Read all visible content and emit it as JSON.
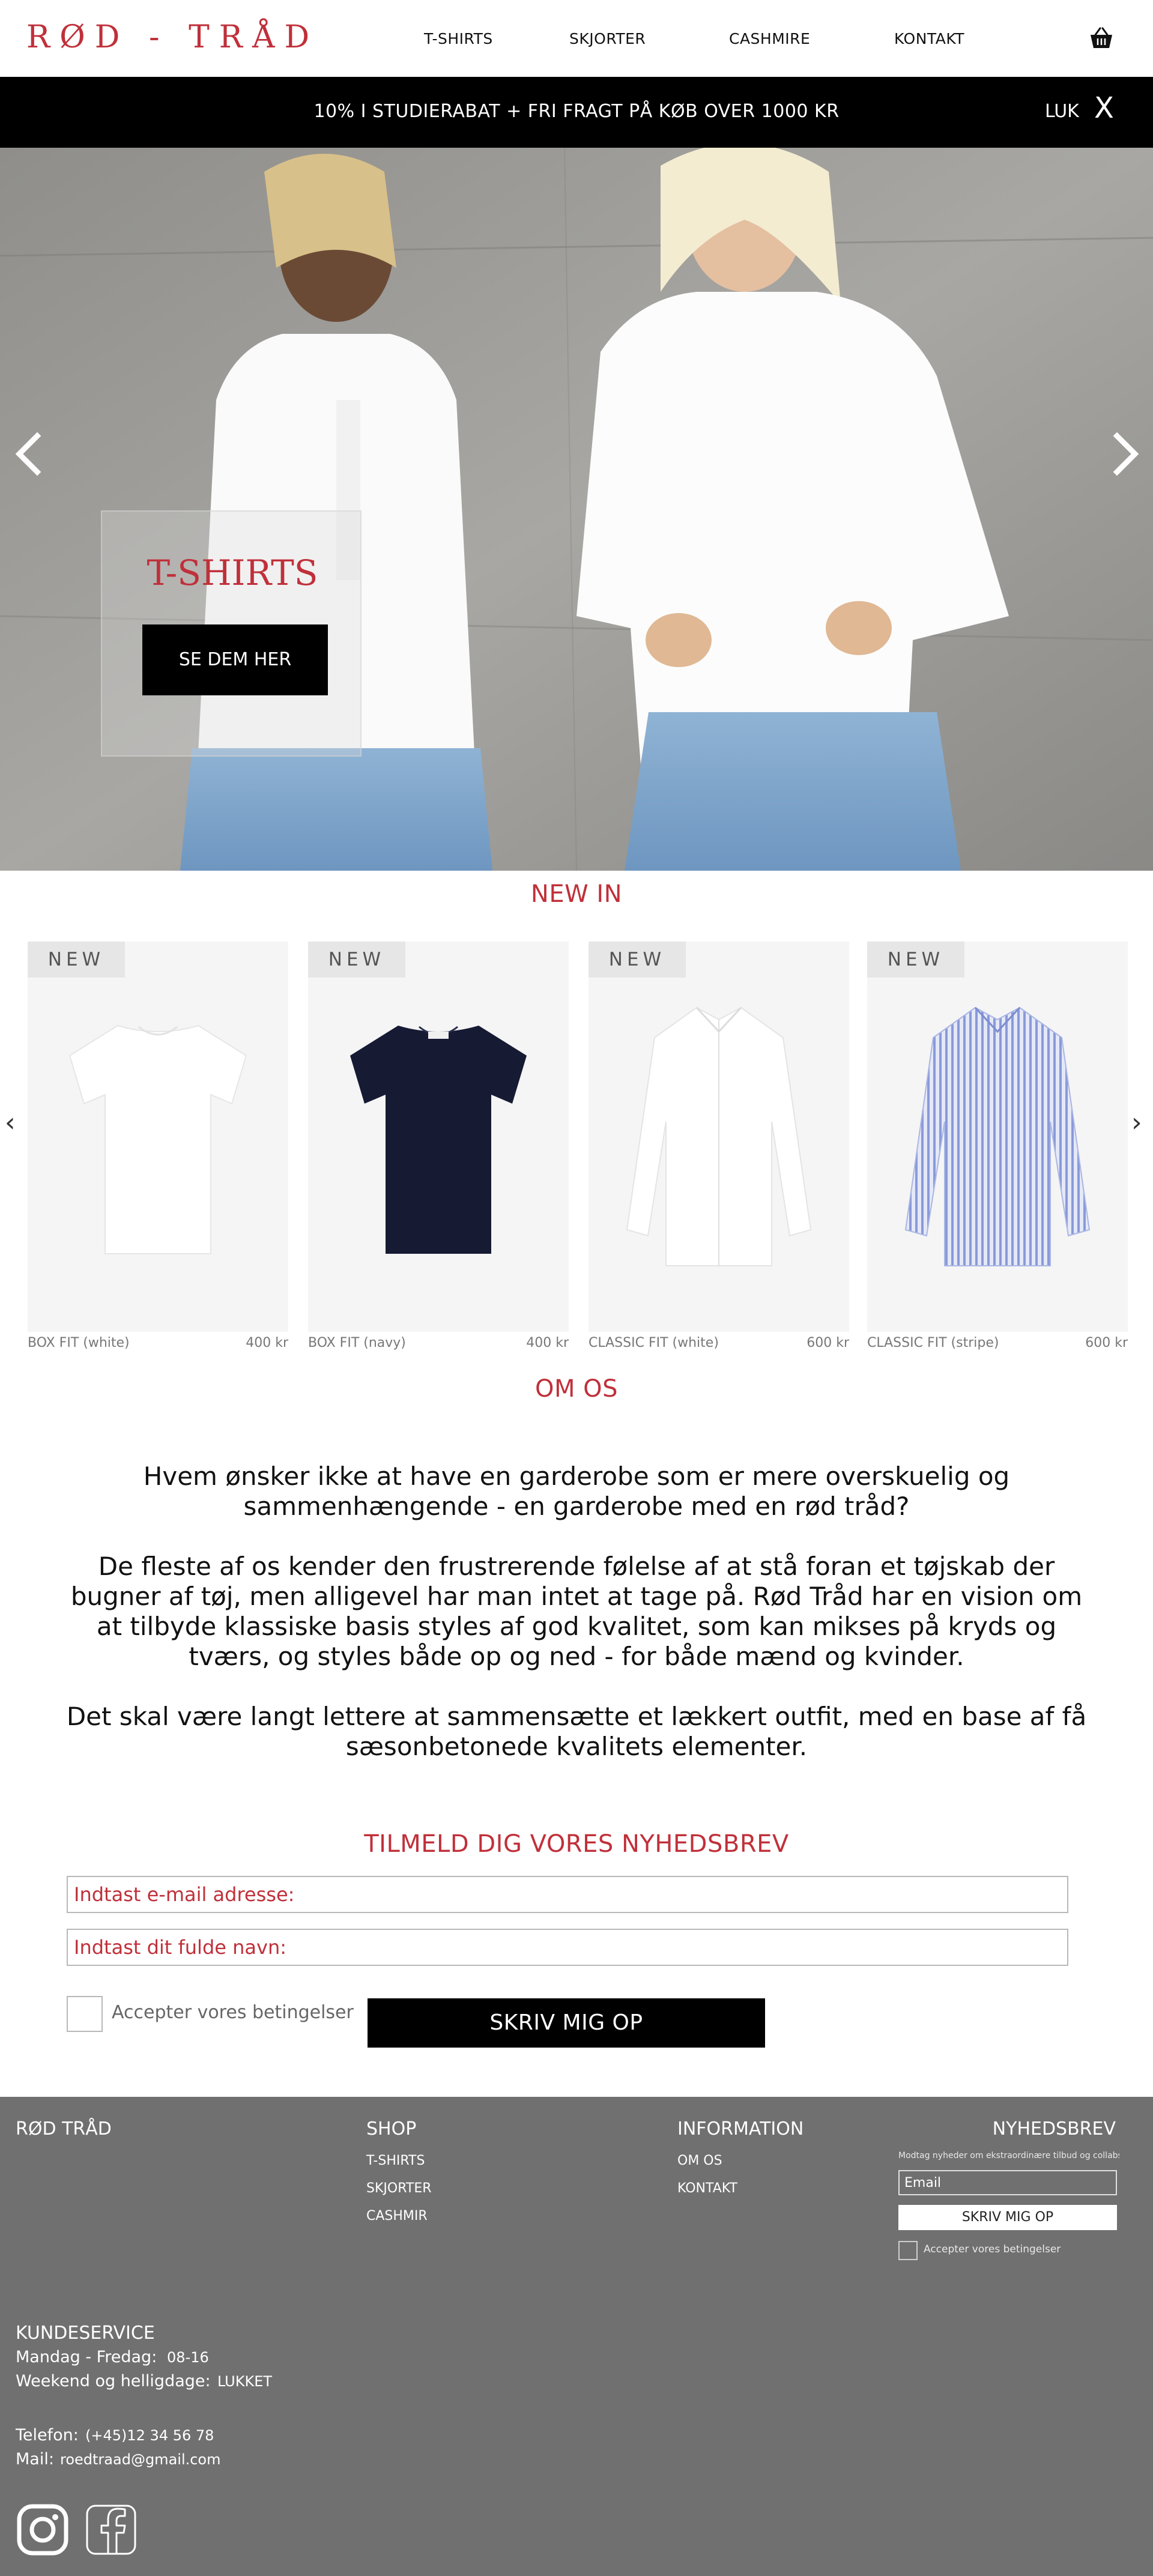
{
  "header": {
    "logo": "RØD - TRÅD",
    "nav": [
      "T-SHIRTS",
      "SKJORTER",
      "CASHMIRE",
      "KONTAKT"
    ],
    "cart_icon": "basket-icon"
  },
  "banner": {
    "text": "10% I STUDIERABAT + FRI FRAGT PÅ KØB OVER 1000 KR",
    "close_label": "LUK",
    "close_x": "X"
  },
  "hero": {
    "title": "T-SHIRTS",
    "button": "SE DEM HER",
    "prev_icon": "chevron-left-icon",
    "next_icon": "chevron-right-icon"
  },
  "new_in": {
    "heading": "NEW IN",
    "prev_arrow": "‹",
    "next_arrow": "›",
    "products": [
      {
        "badge": "NEW",
        "name": "BOX FIT (white)",
        "price": "400 kr",
        "color": "#ffffff"
      },
      {
        "badge": "NEW",
        "name": "BOX FIT (navy)",
        "price": "400 kr",
        "color": "#161a33"
      },
      {
        "badge": "NEW",
        "name": "CLASSIC FIT (white)",
        "price": "600 kr",
        "color": "#ffffff"
      },
      {
        "badge": "NEW",
        "name": "CLASSIC FIT (stripe)",
        "price": "600 kr",
        "color": "#aab6e4"
      }
    ]
  },
  "about": {
    "heading": "OM OS",
    "p1": "Hvem ønsker ikke at have en garderobe som er mere overskuelig og sammenhængende - en garderobe med en rød tråd?",
    "p2": "De fleste af os kender den frustrerende følelse af at stå foran et tøjskab der bugner af tøj, men alligevel har man intet at tage på. Rød Tråd har en vision om at tilbyde klassiske basis styles af god kvalitet, som kan mikses på kryds og tværs, og styles både op og ned - for både mænd og kvinder.",
    "p3": "Det skal være langt lettere at sammensætte et lækkert outfit, med en base af få sæsonbetonede kvalitets elementer."
  },
  "newsletter": {
    "heading": "TILMELD DIG VORES NYHEDSBREV",
    "email_placeholder": "Indtast e-mail adresse:",
    "name_placeholder": "Indtast dit fulde navn:",
    "terms_label": "Accepter vores betingelser",
    "submit": "SKRIV MIG OP"
  },
  "footer": {
    "brand": "RØD TRÅD",
    "shop": {
      "heading": "SHOP",
      "items": [
        "T-SHIRTS",
        "SKJORTER",
        "CASHMIR"
      ]
    },
    "information": {
      "heading": "INFORMATION",
      "items": [
        "OM OS",
        "KONTAKT"
      ]
    },
    "newsletter": {
      "heading": "NYHEDSBREV",
      "description": "Modtag nyheder om ekstraordinære tilbud og collabs",
      "email_placeholder": "Email",
      "submit": "SKRIV MIG OP",
      "terms_label": "Accepter vores betingelser"
    },
    "customer_service": {
      "heading": "KUNDESERVICE",
      "weekday_label": "Mandag - Fredag:",
      "weekday_value": "08-16",
      "weekend_label": "Weekend og helligdage:",
      "weekend_value": "LUKKET",
      "phone_label": "Telefon:",
      "phone_value": "(+45)12 34 56 78",
      "mail_label": "Mail:",
      "mail_value": "roedtraad@gmail.com"
    },
    "social_icons": [
      "instagram-icon",
      "facebook-icon"
    ]
  },
  "colors": {
    "accent": "#c0303a",
    "banner_bg": "#000000",
    "footer_bg": "#707070"
  }
}
